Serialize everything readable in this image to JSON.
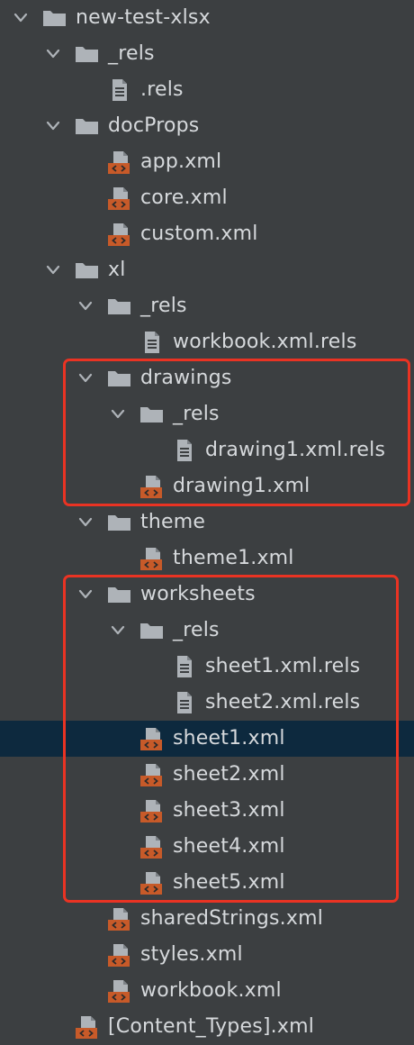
{
  "tree": {
    "items": [
      {
        "label": "new-test-xlsx",
        "type": "folder",
        "level": 0,
        "expanded": true
      },
      {
        "label": "_rels",
        "type": "folder",
        "level": 1,
        "expanded": true
      },
      {
        "label": ".rels",
        "type": "text-file",
        "level": 2
      },
      {
        "label": "docProps",
        "type": "folder",
        "level": 1,
        "expanded": true
      },
      {
        "label": "app.xml",
        "type": "xml-file",
        "level": 2
      },
      {
        "label": "core.xml",
        "type": "xml-file",
        "level": 2
      },
      {
        "label": "custom.xml",
        "type": "xml-file",
        "level": 2
      },
      {
        "label": "xl",
        "type": "folder",
        "level": 1,
        "expanded": true
      },
      {
        "label": "_rels",
        "type": "folder",
        "level": 2,
        "expanded": true
      },
      {
        "label": "workbook.xml.rels",
        "type": "text-file",
        "level": 3
      },
      {
        "label": "drawings",
        "type": "folder",
        "level": 2,
        "expanded": true
      },
      {
        "label": "_rels",
        "type": "folder",
        "level": 3,
        "expanded": true
      },
      {
        "label": "drawing1.xml.rels",
        "type": "text-file",
        "level": 4
      },
      {
        "label": "drawing1.xml",
        "type": "xml-file",
        "level": 3
      },
      {
        "label": "theme",
        "type": "folder",
        "level": 2,
        "expanded": true
      },
      {
        "label": "theme1.xml",
        "type": "xml-file",
        "level": 3
      },
      {
        "label": "worksheets",
        "type": "folder",
        "level": 2,
        "expanded": true
      },
      {
        "label": "_rels",
        "type": "folder",
        "level": 3,
        "expanded": true
      },
      {
        "label": "sheet1.xml.rels",
        "type": "text-file",
        "level": 4
      },
      {
        "label": "sheet2.xml.rels",
        "type": "text-file",
        "level": 4
      },
      {
        "label": "sheet1.xml",
        "type": "xml-file",
        "level": 3,
        "selected": true
      },
      {
        "label": "sheet2.xml",
        "type": "xml-file",
        "level": 3
      },
      {
        "label": "sheet3.xml",
        "type": "xml-file",
        "level": 3
      },
      {
        "label": "sheet4.xml",
        "type": "xml-file",
        "level": 3
      },
      {
        "label": "sheet5.xml",
        "type": "xml-file",
        "level": 3
      },
      {
        "label": "sharedStrings.xml",
        "type": "xml-file",
        "level": 2
      },
      {
        "label": "styles.xml",
        "type": "xml-file",
        "level": 2
      },
      {
        "label": "workbook.xml",
        "type": "xml-file",
        "level": 2
      },
      {
        "label": "[Content_Types].xml",
        "type": "xml-file",
        "level": 1
      }
    ],
    "highlight_groups": [
      {
        "name": "drawings-highlight-box",
        "from": 10,
        "to": 13
      },
      {
        "name": "worksheets-highlight-box",
        "from": 16,
        "to": 24
      }
    ]
  },
  "colors": {
    "background": "#3c3f41",
    "text": "#d6d9dc",
    "folder_icon": "#aeb3b8",
    "text_file_icon": "#aeb3b8",
    "xml_file_icon_top": "#aeb3b8",
    "xml_file_icon_tag": "#c75a29",
    "selection": "#0d293e",
    "highlight_border": "#ea3323"
  }
}
